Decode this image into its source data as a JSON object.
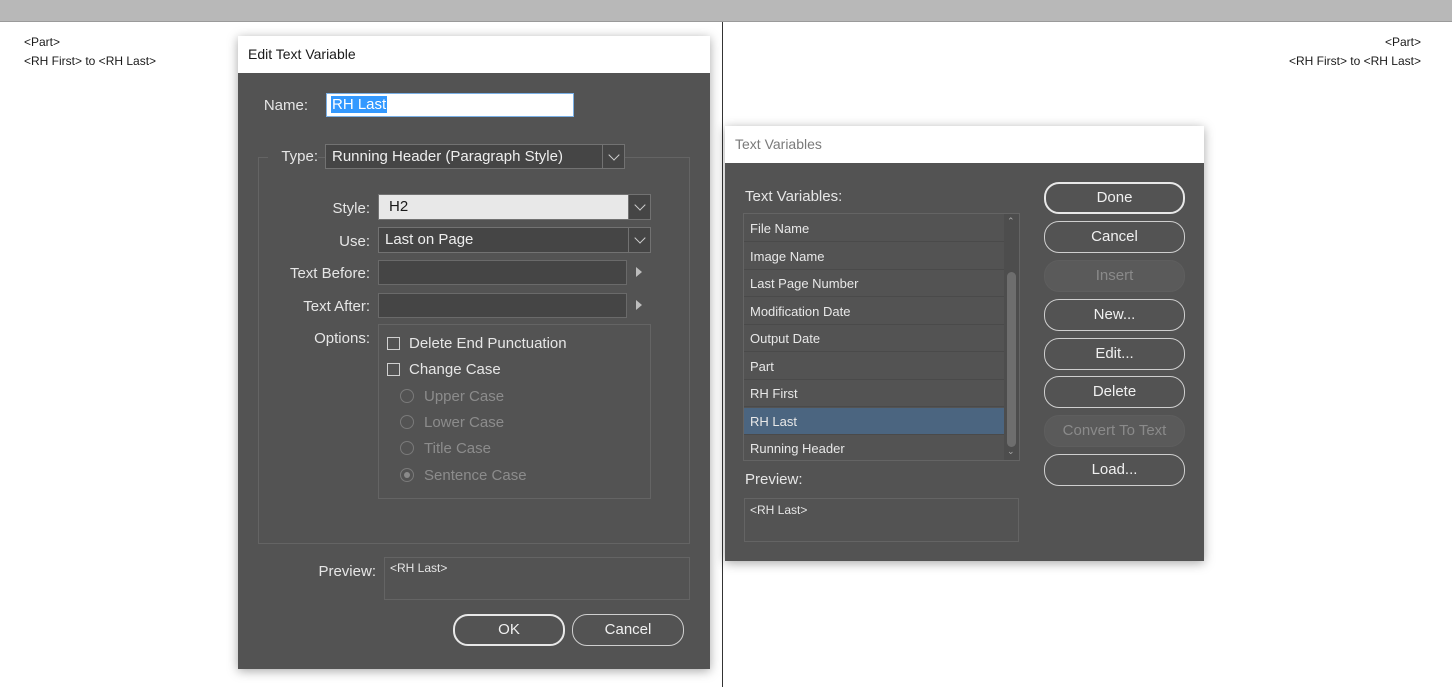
{
  "document": {
    "left_page": {
      "line1": "<Part>",
      "line2": "<RH First> to <RH Last>"
    },
    "right_page": {
      "line1": "<Part>",
      "line2": "<RH First> to <RH Last>"
    }
  },
  "edit_dialog": {
    "title": "Edit Text Variable",
    "name_label": "Name:",
    "name_value": "RH Last",
    "type_label": "Type:",
    "type_value": "Running Header (Paragraph Style)",
    "style_label": "Style:",
    "style_value": "H2",
    "use_label": "Use:",
    "use_value": "Last on Page",
    "text_before_label": "Text Before:",
    "text_before_value": "",
    "text_after_label": "Text After:",
    "text_after_value": "",
    "options_label": "Options:",
    "options": {
      "delete_end_punctuation": "Delete End Punctuation",
      "change_case": "Change Case",
      "upper_case": "Upper Case",
      "lower_case": "Lower Case",
      "title_case": "Title Case",
      "sentence_case": "Sentence Case"
    },
    "preview_label": "Preview:",
    "preview_value": "<RH Last>",
    "ok_label": "OK",
    "cancel_label": "Cancel"
  },
  "variables_dialog": {
    "title": "Text Variables",
    "list_label": "Text Variables:",
    "items": [
      "File Name",
      "Image Name",
      "Last Page Number",
      "Modification Date",
      "Output Date",
      "Part",
      "RH First",
      "RH Last",
      "Running Header"
    ],
    "selected": "RH Last",
    "preview_label": "Preview:",
    "preview_value": "<RH Last>",
    "buttons": {
      "done": "Done",
      "cancel": "Cancel",
      "insert": "Insert",
      "new": "New...",
      "edit": "Edit...",
      "delete": "Delete",
      "convert": "Convert To Text",
      "load": "Load..."
    }
  },
  "colors": {
    "dialog_bg": "#535353",
    "selection": "#4b6580",
    "text_selection": "#3399ff"
  }
}
